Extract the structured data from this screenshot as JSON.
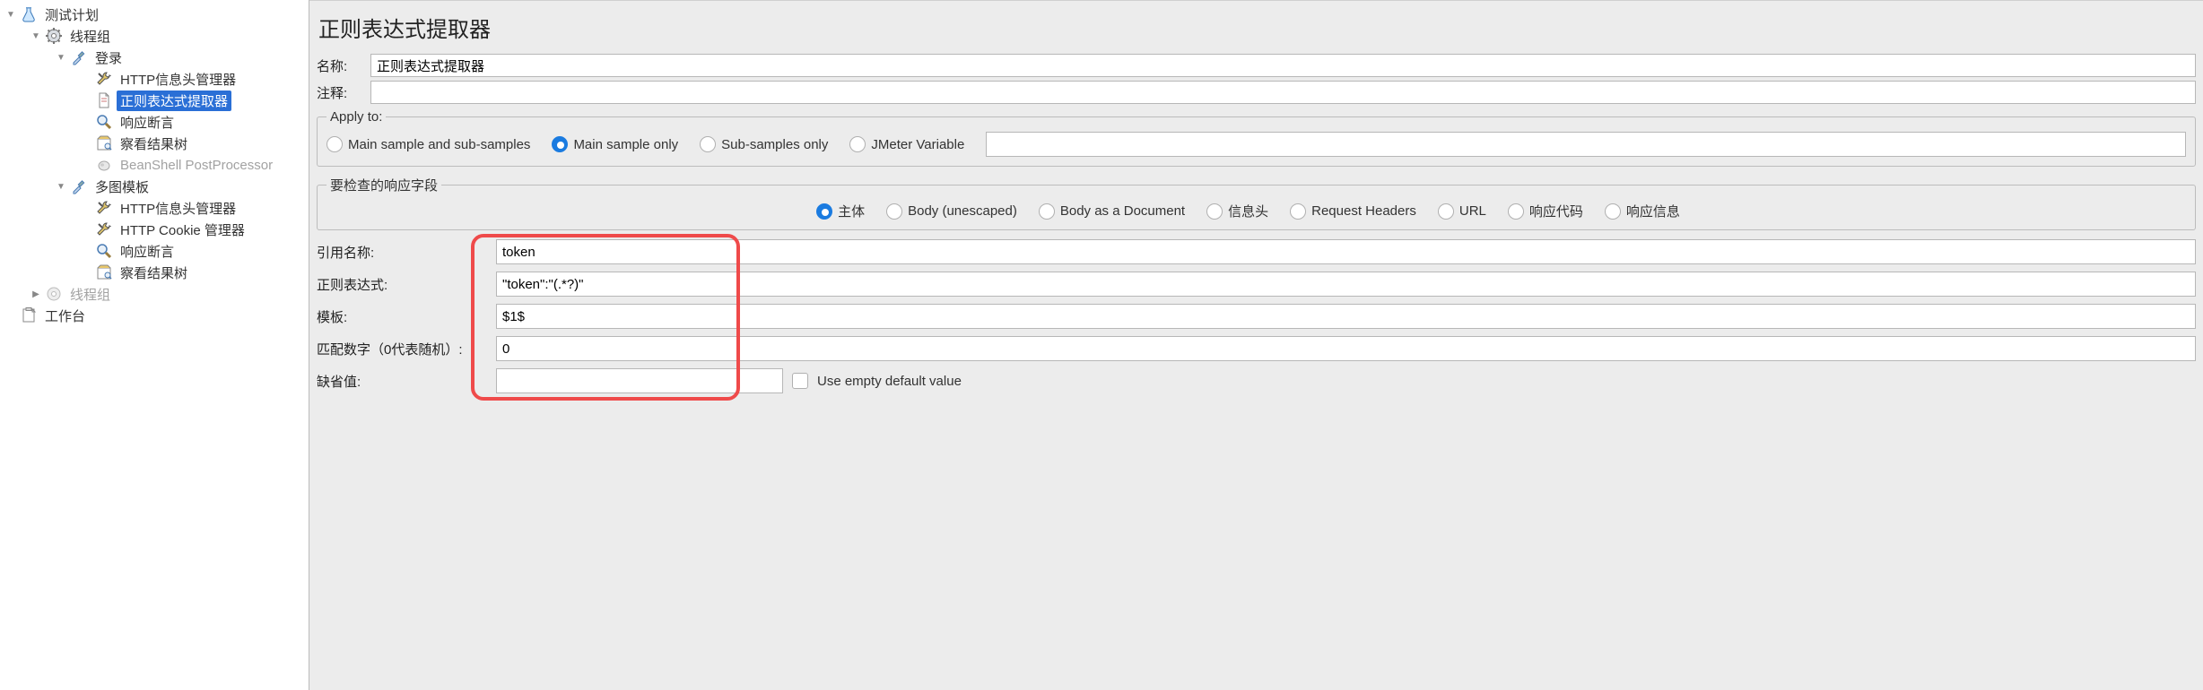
{
  "tree": {
    "test_plan": "测试计划",
    "thread_group_1": "线程组",
    "login": "登录",
    "http_header_mgr": "HTTP信息头管理器",
    "regex_extractor": "正则表达式提取器",
    "response_assertion": "响应断言",
    "view_results_tree": "察看结果树",
    "beanshell_pp": "BeanShell PostProcessor",
    "multi_template": "多图模板",
    "http_header_mgr2": "HTTP信息头管理器",
    "http_cookie_mgr": "HTTP Cookie 管理器",
    "response_assertion2": "响应断言",
    "view_results_tree2": "察看结果树",
    "thread_group_2": "线程组",
    "workbench": "工作台"
  },
  "panel": {
    "title": "正则表达式提取器",
    "name_label": "名称:",
    "name_value": "正则表达式提取器",
    "comment_label": "注释:",
    "comment_value": ""
  },
  "apply_to": {
    "legend": "Apply to:",
    "opt_main_sub": "Main sample and sub-samples",
    "opt_main_only": "Main sample only",
    "opt_sub_only": "Sub-samples only",
    "opt_jmeter_var": "JMeter Variable",
    "selected": "opt_main_only",
    "var_value": ""
  },
  "field_to_check": {
    "legend": "要检查的响应字段",
    "opt_body": "主体",
    "opt_body_unescaped": "Body (unescaped)",
    "opt_body_doc": "Body as a Document",
    "opt_headers": "信息头",
    "opt_request_headers": "Request Headers",
    "opt_url": "URL",
    "opt_response_code": "响应代码",
    "opt_response_msg": "响应信息",
    "selected": "opt_body"
  },
  "params": {
    "ref_name_label": "引用名称:",
    "ref_name_value": "token",
    "regex_label": "正则表达式:",
    "regex_value": "\"token\":\"(.*?)\"",
    "template_label": "模板:",
    "template_value": "$1$",
    "match_no_label": "匹配数字（0代表随机）:",
    "match_no_value": "0",
    "default_label": "缺省值:",
    "default_value": "",
    "use_empty_label": "Use empty default value"
  }
}
